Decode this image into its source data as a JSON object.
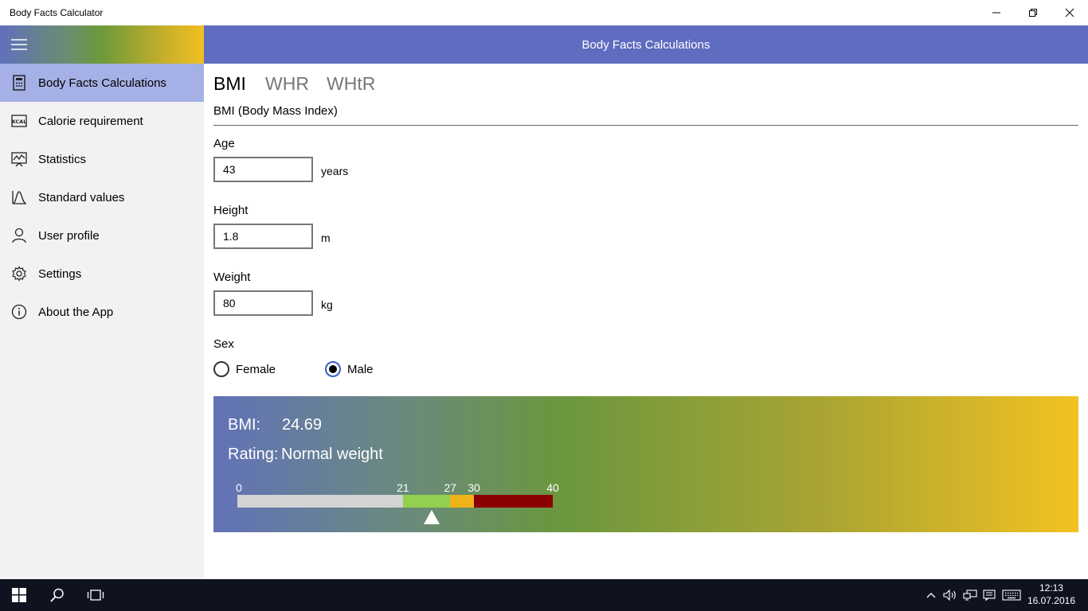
{
  "window": {
    "title": "Body Facts Calculator"
  },
  "sidebar": {
    "items": [
      {
        "label": "Body Facts Calculations",
        "icon": "calculator-icon"
      },
      {
        "label": "Calorie requirement",
        "icon": "kcal-icon"
      },
      {
        "label": "Statistics",
        "icon": "chart-icon"
      },
      {
        "label": "Standard values",
        "icon": "curve-icon"
      },
      {
        "label": "User profile",
        "icon": "person-icon"
      },
      {
        "label": "Settings",
        "icon": "gear-icon"
      },
      {
        "label": "About the App",
        "icon": "info-icon"
      }
    ],
    "kcal_icon_text": "KCAL"
  },
  "header": {
    "title": "Body Facts Calculations"
  },
  "tabs": [
    "BMI",
    "WHR",
    "WHtR"
  ],
  "section_title": "BMI (Body Mass Index)",
  "form": {
    "age": {
      "label": "Age",
      "value": "43",
      "unit": "years"
    },
    "height": {
      "label": "Height",
      "value": "1.8",
      "unit": "m"
    },
    "weight": {
      "label": "Weight",
      "value": "80",
      "unit": "kg"
    },
    "sex": {
      "label": "Sex",
      "options": [
        "Female",
        "Male"
      ],
      "selected": "Male"
    }
  },
  "result": {
    "bmi_label": "BMI:",
    "bmi_value": "24.69",
    "rating_label": "Rating:",
    "rating_value": "Normal weight",
    "scale_ticks": [
      "0",
      "21",
      "27",
      "30",
      "40"
    ],
    "scale_min": 0,
    "scale_max": 40,
    "segments": [
      {
        "from": 0,
        "to": 21,
        "color": "#d3d3d3"
      },
      {
        "from": 21,
        "to": 27,
        "color": "#92d050"
      },
      {
        "from": 27,
        "to": 30,
        "color": "#f0b21a"
      },
      {
        "from": 30,
        "to": 40,
        "color": "#8b0000"
      }
    ],
    "pointer_value": 24.69
  },
  "taskbar": {
    "time": "12:13",
    "date": "16.07.2016"
  },
  "colors": {
    "header": "#5f6cbf",
    "active_nav": "#a5b0e6"
  }
}
